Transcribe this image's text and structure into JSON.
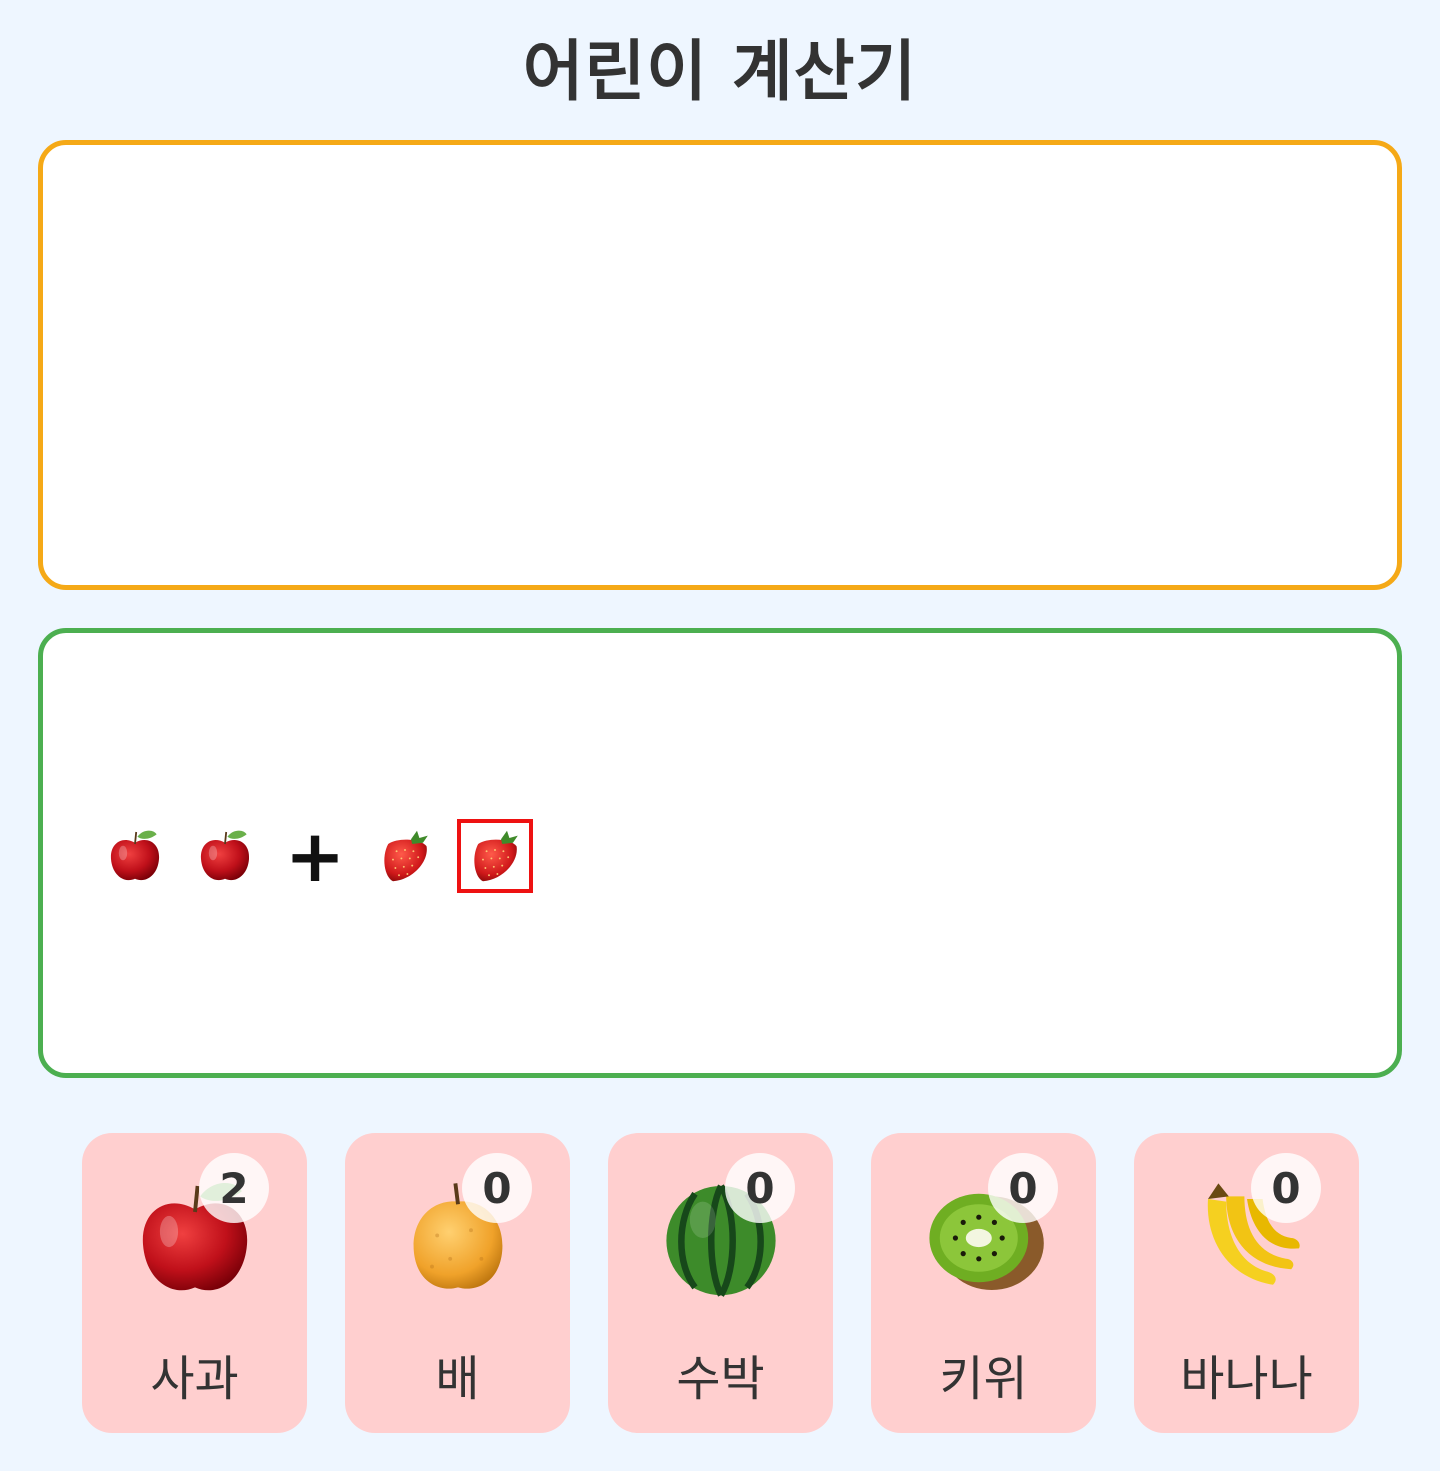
{
  "app": {
    "title": "어린이 계산기"
  },
  "equation": {
    "items": [
      {
        "kind": "fruit",
        "icon": "apple-icon"
      },
      {
        "kind": "fruit",
        "icon": "apple-icon"
      },
      {
        "kind": "operator",
        "symbol": "+"
      },
      {
        "kind": "fruit",
        "icon": "strawberry-icon"
      },
      {
        "kind": "fruit",
        "icon": "strawberry-icon",
        "selected": true
      }
    ]
  },
  "fruits": [
    {
      "label": "사과",
      "count": "2",
      "icon": "apple-icon"
    },
    {
      "label": "배",
      "count": "0",
      "icon": "pear-icon"
    },
    {
      "label": "수박",
      "count": "0",
      "icon": "watermelon-icon"
    },
    {
      "label": "키위",
      "count": "0",
      "icon": "kiwi-icon"
    },
    {
      "label": "바나나",
      "count": "0",
      "icon": "banana-icon"
    }
  ],
  "colors": {
    "background": "#eef6ff",
    "result_border": "#f5a917",
    "equation_border": "#4caf50",
    "card_background": "#ffcfcf",
    "selection": "#ee1111"
  }
}
